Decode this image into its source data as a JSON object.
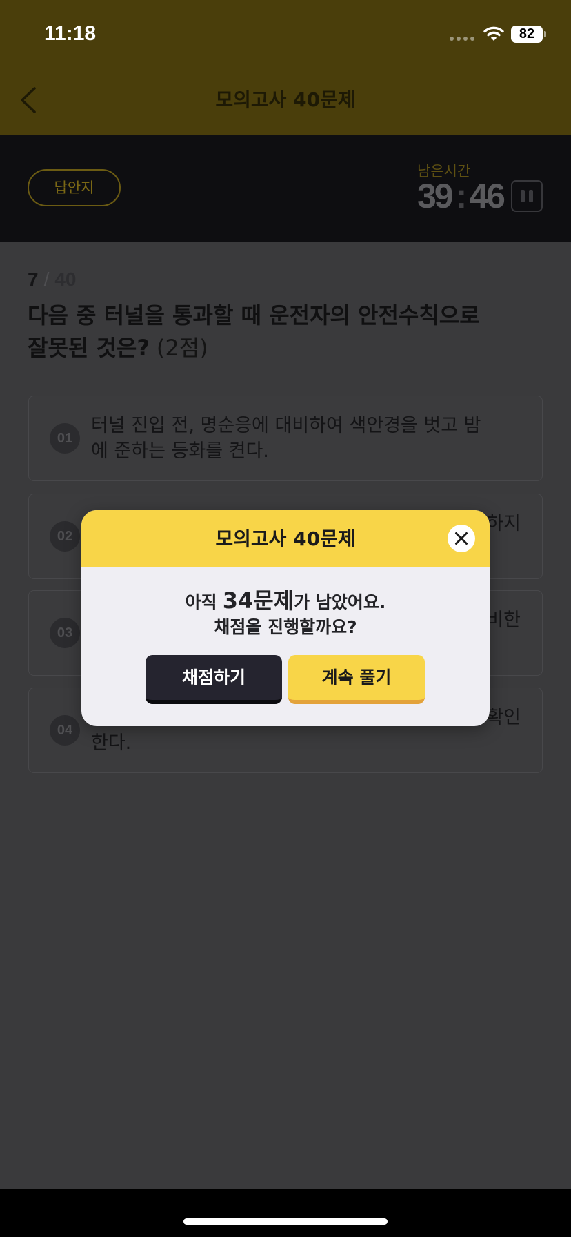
{
  "status_bar": {
    "time": "11:18",
    "battery_level": "82",
    "icons": [
      "cellular-signal-icon",
      "wifi-icon",
      "battery-icon"
    ]
  },
  "header": {
    "title": "모의고사 40문제",
    "back_icon": "chevron-left-icon"
  },
  "exam_bar": {
    "answer_sheet_button": "답안지",
    "remaining_time_label": "남은시간",
    "timer": {
      "minutes": "39",
      "separator": ":",
      "seconds": "46"
    },
    "pause_icon": "pause-icon"
  },
  "question": {
    "current": "7",
    "separator": "/",
    "total": "40",
    "lines": [
      "다음 중 터널을 통과할 때 운전자의 안전수칙으로",
      "잘못된 것은?"
    ],
    "points": "(2점)"
  },
  "options": [
    {
      "number": "01",
      "lines": [
        "터널 진입 전, 명순응에 대비하여 색안경을 벗고 밤",
        "에 준하는 등화를 켠다."
      ]
    },
    {
      "number": "02",
      "line1_visible_end": "하지"
    },
    {
      "number": "03",
      "line1_visible_end": "비한"
    },
    {
      "number": "04",
      "line1_visible_end": "확인",
      "line2": "한다."
    }
  ],
  "modal": {
    "title": "모의고사 40문제",
    "message": {
      "prefix": "아직",
      "count": "34문제",
      "suffix": "가 남았어요.",
      "line2": "채점을 진행할까요?"
    },
    "buttons": {
      "grade": "채점하기",
      "continue": "계속 풀기"
    },
    "close_icon": "close-icon"
  },
  "colors": {
    "accent_yellow": "#f8d548",
    "modal_body": "#efeef3",
    "dark_button": "#25242f",
    "continue_button_shadow": "#e3a23a",
    "dimmed_content": "#3a3a3c",
    "dimmed_header": "#4a3e0b"
  }
}
